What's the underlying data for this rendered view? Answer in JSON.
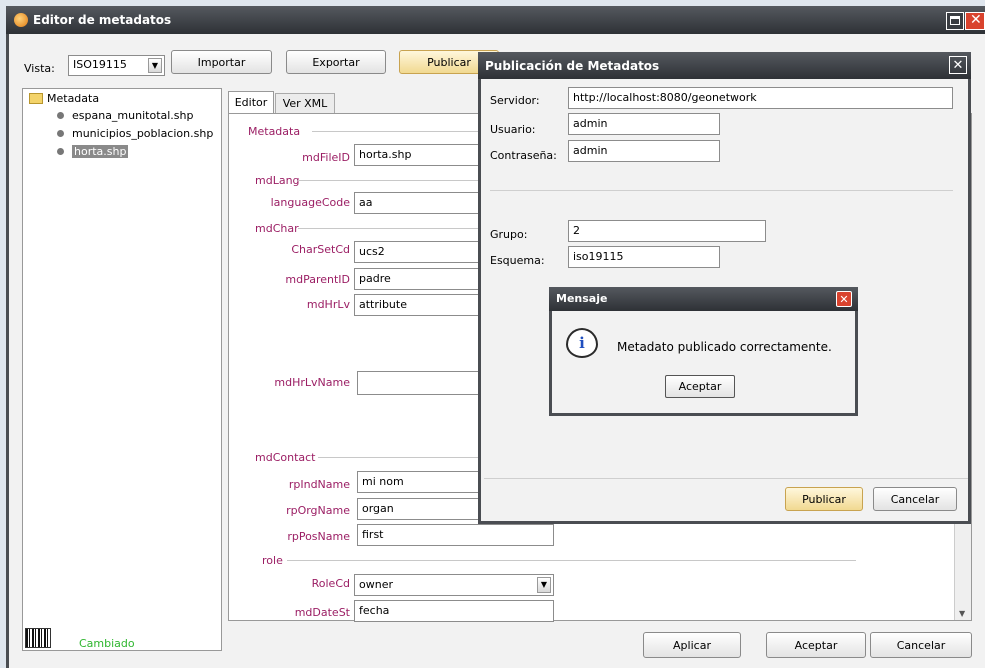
{
  "window": {
    "title": "Editor de metadatos"
  },
  "toolbar": {
    "vista_label": "Vista:",
    "vista_value": "ISO19115",
    "importar": "Importar",
    "exportar": "Exportar",
    "publicar": "Publicar"
  },
  "tree": {
    "root": "Metadata",
    "items": [
      "espana_munitotal.shp",
      "municipios_poblacion.shp",
      "horta.shp"
    ]
  },
  "tabs": {
    "editor": "Editor",
    "xml": "Ver XML"
  },
  "form": {
    "metadata_section": "Metadata",
    "mdFileID_label": "mdFileID",
    "mdFileID_value": "horta.shp",
    "mdLang_section": "mdLang",
    "languageCode_label": "languageCode",
    "languageCode_value": "aa",
    "mdChar_section": "mdChar",
    "charSetCd_label": "CharSetCd",
    "charSetCd_value": "ucs2",
    "mdParentID_label": "mdParentID",
    "mdParentID_value": "padre",
    "mdHrLv_label": "mdHrLv",
    "mdHrLv_value": "attribute",
    "mdHrLvName_label": "mdHrLvName",
    "mdHrLvName_value": "",
    "mdContact_section": "mdContact",
    "rpIndName_label": "rpIndName",
    "rpIndName_value": "mi nom",
    "rpOrgName_label": "rpOrgName",
    "rpOrgName_value": "organ",
    "rpPosName_label": "rpPosName",
    "rpPosName_value": "first",
    "role_section": "role",
    "roleCd_label": "RoleCd",
    "roleCd_value": "owner",
    "mdDateSt_label": "mdDateSt",
    "mdDateSt_value": "fecha"
  },
  "status": {
    "text": "Cambiado",
    "color": "#2fb62f"
  },
  "bottom_buttons": {
    "aplicar": "Aplicar",
    "aceptar": "Aceptar",
    "cancelar": "Cancelar"
  },
  "publish_dialog": {
    "title": "Publicación de Metadatos",
    "servidor_label": "Servidor:",
    "servidor_value": "http://localhost:8080/geonetwork",
    "usuario_label": "Usuario:",
    "usuario_value": "admin",
    "contrasena_label": "Contraseña:",
    "contrasena_value": "admin",
    "grupo_label": "Grupo:",
    "grupo_value": "2",
    "esquema_label": "Esquema:",
    "esquema_value": "iso19115",
    "publicar": "Publicar",
    "cancelar": "Cancelar"
  },
  "message_dialog": {
    "title": "Mensaje",
    "text": "Metadato publicado correctamente.",
    "aceptar": "Aceptar"
  }
}
